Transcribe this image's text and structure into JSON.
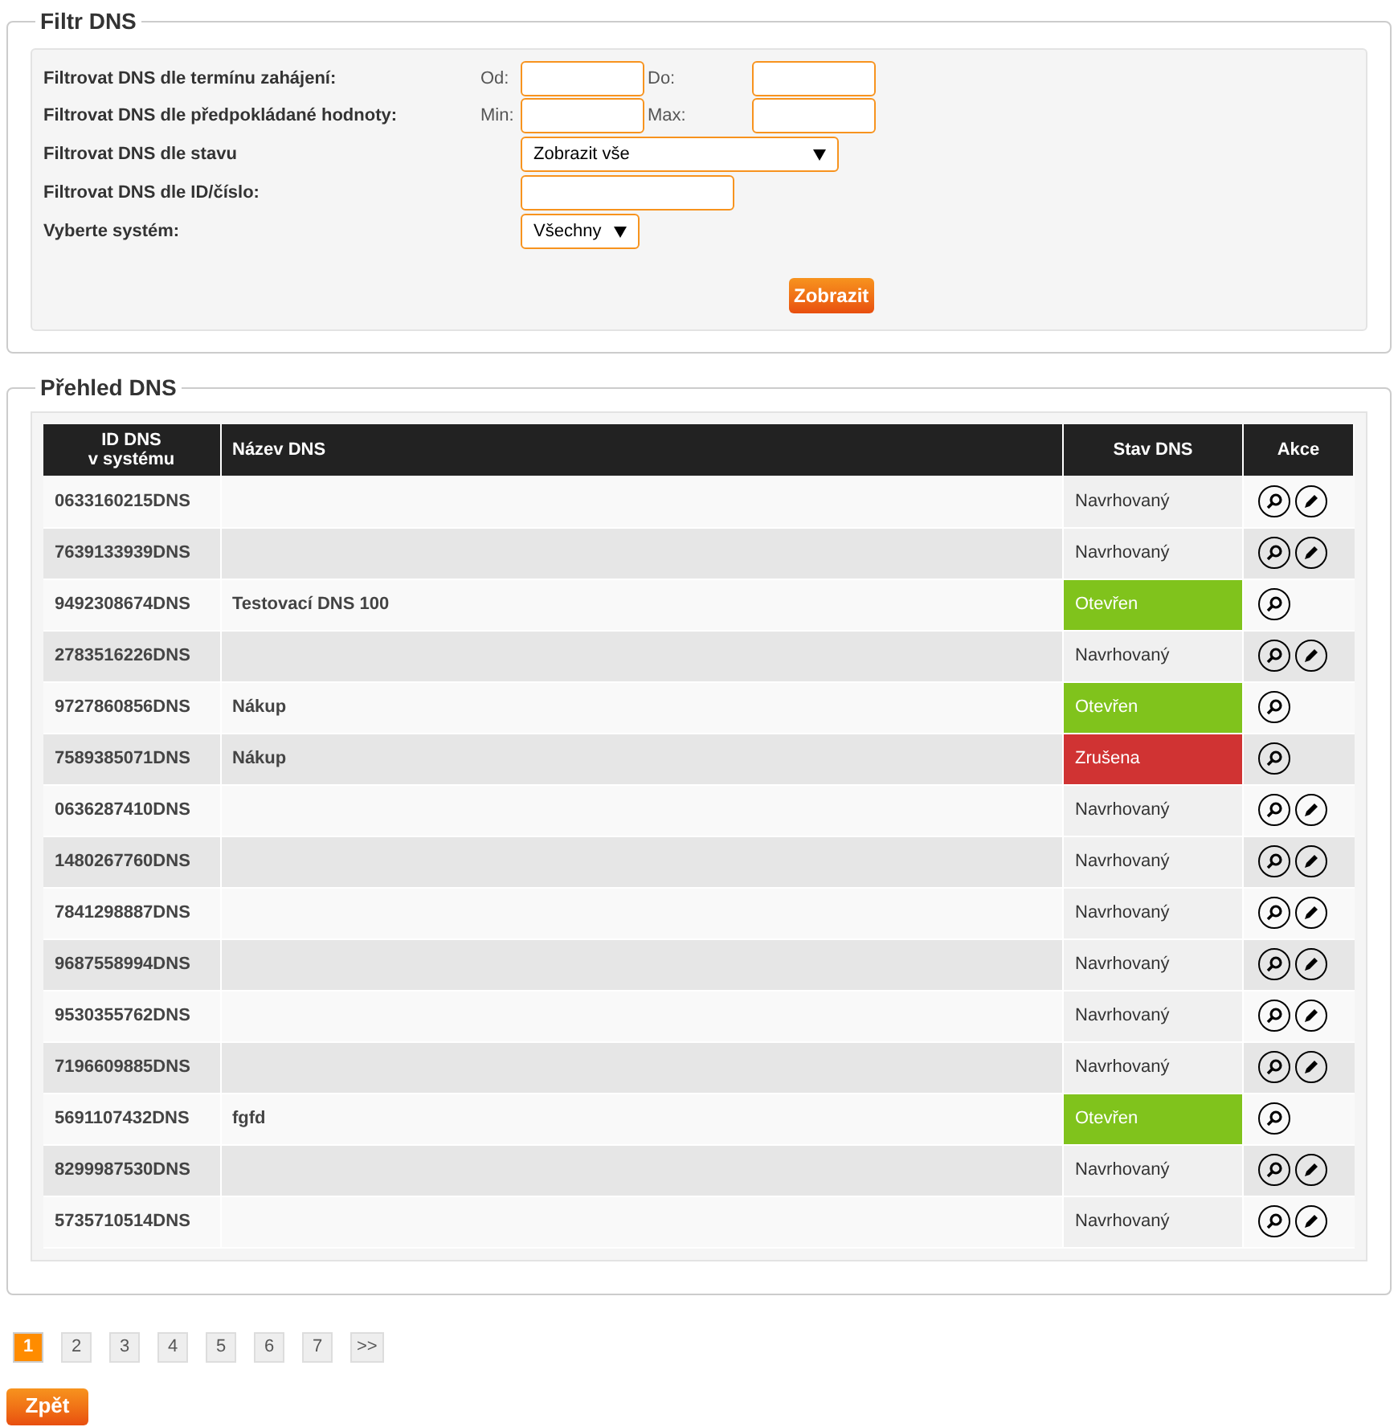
{
  "filter": {
    "title": "Filtr DNS",
    "start_date": {
      "label": "Filtrovat DNS dle termínu zahájení:",
      "from_label": "Od:",
      "to_label": "Do:"
    },
    "value": {
      "label": "Filtrovat DNS dle předpokládané hodnoty:",
      "min_label": "Min:",
      "max_label": "Max:"
    },
    "status": {
      "label": "Filtrovat DNS dle stavu",
      "value": "Zobrazit vše"
    },
    "id": {
      "label": "Filtrovat DNS dle ID/číslo:"
    },
    "system": {
      "label": "Vyberte systém:",
      "value": "Všechny"
    },
    "submit": "Zobrazit"
  },
  "overview": {
    "title": "Přehled DNS",
    "columns": [
      "ID DNS\nv systému",
      "Název DNS",
      "Stav DNS",
      "Akce"
    ],
    "rows": [
      {
        "id": "0633160215DNS",
        "name": "",
        "status": "Navrhovaný",
        "kind": "proposed",
        "edit": true
      },
      {
        "id": "7639133939DNS",
        "name": "",
        "status": "Navrhovaný",
        "kind": "proposed",
        "edit": true
      },
      {
        "id": "9492308674DNS",
        "name": "Testovací DNS 100",
        "status": "Otevřen",
        "kind": "open",
        "edit": false
      },
      {
        "id": "2783516226DNS",
        "name": "",
        "status": "Navrhovaný",
        "kind": "proposed",
        "edit": true
      },
      {
        "id": "9727860856DNS",
        "name": "Nákup",
        "status": "Otevřen",
        "kind": "open",
        "edit": false
      },
      {
        "id": "7589385071DNS",
        "name": "Nákup",
        "status": "Zrušena",
        "kind": "cancelled",
        "edit": false
      },
      {
        "id": "0636287410DNS",
        "name": "",
        "status": "Navrhovaný",
        "kind": "proposed",
        "edit": true
      },
      {
        "id": "1480267760DNS",
        "name": "",
        "status": "Navrhovaný",
        "kind": "proposed",
        "edit": true
      },
      {
        "id": "7841298887DNS",
        "name": "",
        "status": "Navrhovaný",
        "kind": "proposed",
        "edit": true
      },
      {
        "id": "9687558994DNS",
        "name": "",
        "status": "Navrhovaný",
        "kind": "proposed",
        "edit": true
      },
      {
        "id": "9530355762DNS",
        "name": "",
        "status": "Navrhovaný",
        "kind": "proposed",
        "edit": true
      },
      {
        "id": "7196609885DNS",
        "name": "",
        "status": "Navrhovaný",
        "kind": "proposed",
        "edit": true
      },
      {
        "id": "5691107432DNS",
        "name": "fgfd",
        "status": "Otevřen",
        "kind": "open",
        "edit": false
      },
      {
        "id": "8299987530DNS",
        "name": "",
        "status": "Navrhovaný",
        "kind": "proposed",
        "edit": true
      },
      {
        "id": "5735710514DNS",
        "name": "",
        "status": "Navrhovaný",
        "kind": "proposed",
        "edit": true
      }
    ]
  },
  "pagination": [
    {
      "label": "1",
      "selected": true
    },
    {
      "label": "2",
      "selected": false
    },
    {
      "label": "3",
      "selected": false
    },
    {
      "label": "4",
      "selected": false
    },
    {
      "label": "5",
      "selected": false
    },
    {
      "label": "6",
      "selected": false
    },
    {
      "label": "7",
      "selected": false
    },
    {
      "label": ">>",
      "selected": false
    }
  ],
  "back_button": "Zpět"
}
